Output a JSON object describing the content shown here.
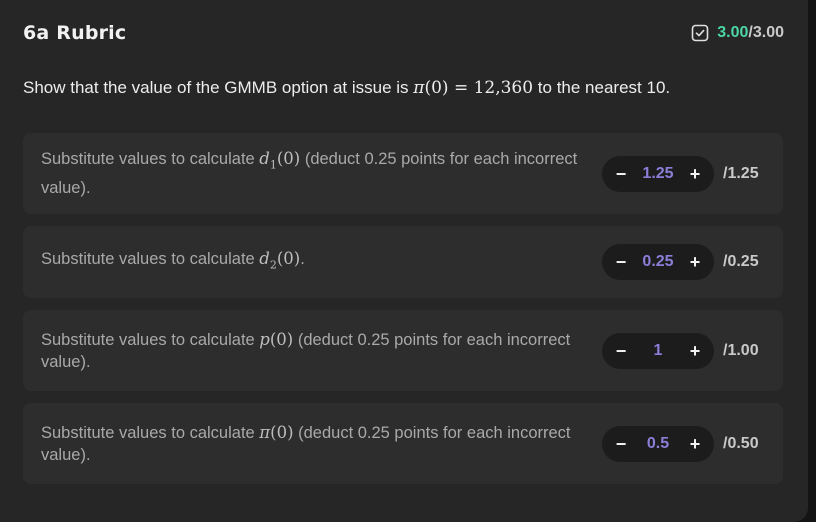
{
  "header": {
    "title": "6a Rubric",
    "score_earned": "3.00",
    "score_separator": "/",
    "score_total": "3.00",
    "score_icon": "checkbox-checked-icon"
  },
  "question": {
    "prefix": "Show that the value of the GMMB option at issue is ",
    "math": "π(0) = 12,360",
    "suffix": " to the nearest 10."
  },
  "criteria": [
    {
      "desc_prefix": "Substitute values to calculate ",
      "math": "d1(0)",
      "desc_suffix": " (deduct 0.25 points for each incorrect value).",
      "value": "1.25",
      "max": "/1.25"
    },
    {
      "desc_prefix": "Substitute values to calculate ",
      "math": "d2(0)",
      "desc_suffix": ".",
      "value": "0.25",
      "max": "/0.25"
    },
    {
      "desc_prefix": "Substitute values to calculate ",
      "math": "p(0)",
      "desc_suffix": " (deduct 0.25 points for each incorrect value).",
      "value": "1",
      "max": "/1.00"
    },
    {
      "desc_prefix": "Substitute values to calculate ",
      "math": "π(0)",
      "desc_suffix": " (deduct 0.25 points for each incorrect value).",
      "value": "0.5",
      "max": "/0.50"
    }
  ],
  "stepper": {
    "minus": "−",
    "plus": "+"
  },
  "colors": {
    "accent_score": "#4bd6a4",
    "accent_value": "#8a7ed8",
    "panel_bg": "#262626",
    "card_bg": "#2d2d2d"
  }
}
